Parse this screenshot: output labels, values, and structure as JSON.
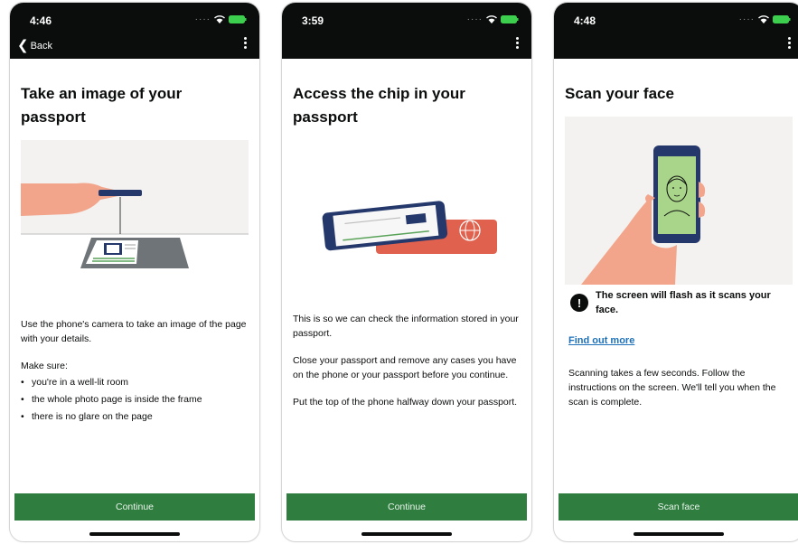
{
  "screens": [
    {
      "time": "4:46",
      "back_label": "Back",
      "title": "Take an image of your passport",
      "paragraphs": [
        "Use the phone's camera to take an image of the page with your details."
      ],
      "make_sure": "Make sure:",
      "bullets": [
        "you're in a well-lit room",
        "the whole photo page is inside the frame",
        "there is no glare on the page"
      ],
      "button": "Continue"
    },
    {
      "time": "3:59",
      "title": "Access the chip in your passport",
      "paragraphs": [
        "This is so we can check the information stored in your passport.",
        "Close your passport and remove any cases you have on the phone or your passport before you continue.",
        "Put the top of the phone halfway down your passport."
      ],
      "button": "Continue"
    },
    {
      "time": "4:48",
      "title": "Scan your face",
      "warning": "The screen will flash as it scans your face.",
      "link": "Find out more",
      "paragraphs": [
        "Scanning takes a few seconds. Follow the instructions on the screen. We'll tell you when the scan is complete."
      ],
      "button": "Scan face"
    }
  ],
  "colors": {
    "header": "#0b0c0c",
    "button": "#2f7d3f",
    "link": "#1d70b8",
    "illustration_bg": "#f3f2f1",
    "skin": "#f2a58a",
    "passport": "#e0624e",
    "phone_blue": "#25386b",
    "face_green": "#a9d58a"
  }
}
